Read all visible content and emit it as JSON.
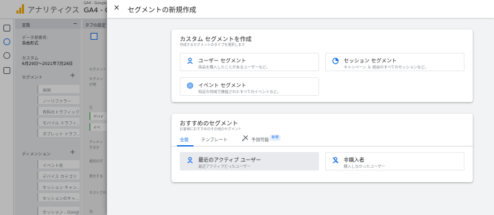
{
  "app": {
    "name": "アナリティクス",
    "property_line1": "GA4 - Google",
    "property_line2": "GA4 - G"
  },
  "bg_panel": {
    "header": "変数",
    "data_label": "データ探索名:",
    "data_name": "自由形式",
    "custom_label": "カスタム",
    "date_range": "6月29日～2021年7月28日",
    "segments_header": "セグメント",
    "segments": [
      "米国",
      "ノーリファラー",
      "有料のトラフィック",
      "モバイル トラフィ...",
      "タブレット トラフ..."
    ],
    "dimensions_header": "ディメンション",
    "dimensions": [
      "イベント名",
      "デバイス カテゴリ",
      "セッション キャン...",
      "セッションのキャ...",
      "セッション - Googl..."
    ]
  },
  "bg_tab": {
    "header": "タブの設定",
    "segment_label": "セグメント",
    "segment_text_1": "セグメン",
    "segment_text_2": "が適",
    "rows_label": "行",
    "row_items": [
      "デバイ",
      "イベ"
    ],
    "dim_text_1": "ディメン",
    "dim_text_2": "するか",
    "start_label": "最初の行",
    "show_label": "表示する",
    "nested_label": "ネストされ",
    "cols_label": "列"
  },
  "sheet": {
    "title": "セグメントの新規作成",
    "close_label": "✕"
  },
  "custom_card": {
    "title": "カスタム セグメントを作成",
    "subtitle": "作成するセグメントのタイプを選択します",
    "options": [
      {
        "title": "ユーザー セグメント",
        "desc": "商品を購入したことがあるユーザーなど。"
      },
      {
        "title": "セッション セグメント",
        "desc": "キャンペーン ＆ 経由のすべてのセッションなど。"
      },
      {
        "title": "イベント セグメント",
        "desc": "特定の地域で開催されたすべてのイベントなど。"
      }
    ]
  },
  "suggested_card": {
    "title": "おすすめのセグメント",
    "subtitle": "お客様におすすめのその他のセグメント",
    "tabs": [
      "全般",
      "テンプレート",
      "予測可能"
    ],
    "new_badge": "新規",
    "options": [
      {
        "title": "最近のアクティブ ユーザー",
        "desc": "最近アクティブだったユーザー"
      },
      {
        "title": "非購入者",
        "desc": "購入しなかったユーザー"
      }
    ]
  },
  "colors": {
    "accent": "#1a73e8",
    "ga_orange": "#f9ab00"
  }
}
